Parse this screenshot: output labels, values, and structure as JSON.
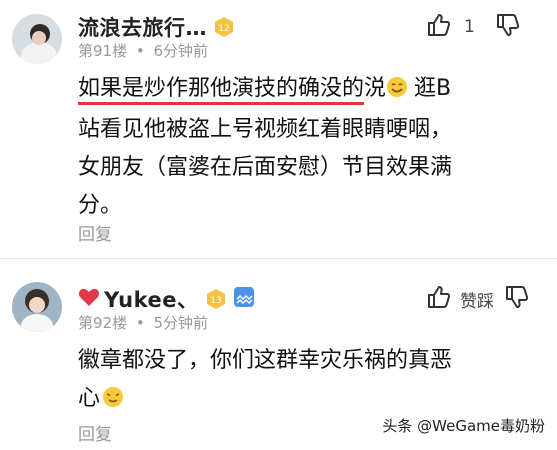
{
  "comments": [
    {
      "username": "流浪去旅行…",
      "level": "12",
      "floor": "第91楼",
      "sep": "•",
      "time": "6分钟前",
      "like_count": "1",
      "text_underlined": "如果是炒作那他演技的确没的",
      "text_rest_1": "涚",
      "text_rest_2": "逛B",
      "text_line2": "站看见他被盗上号视频红着眼睛哽咽，",
      "text_line3": "女朋友（富婆在后面安慰）节目效果满",
      "text_line4": "分。",
      "reply_label": "回复",
      "accent": "#e23636"
    },
    {
      "username": "Yukee、",
      "level": "13",
      "floor": "第92楼",
      "sep": "•",
      "time": "5分钟前",
      "dislike_label": "赞踩",
      "text_line1": "徽章都没了，你们这群幸灾乐祸的真恶",
      "text_line2": "心",
      "reply_label": "回复"
    }
  ],
  "watermark": "头条 @WeGame毒奶粉",
  "icons": [
    "thumbs-up-icon",
    "thumbs-down-icon",
    "level-badge-icon",
    "heart-icon",
    "gallery-badge-icon",
    "smile-emoji-icon"
  ]
}
